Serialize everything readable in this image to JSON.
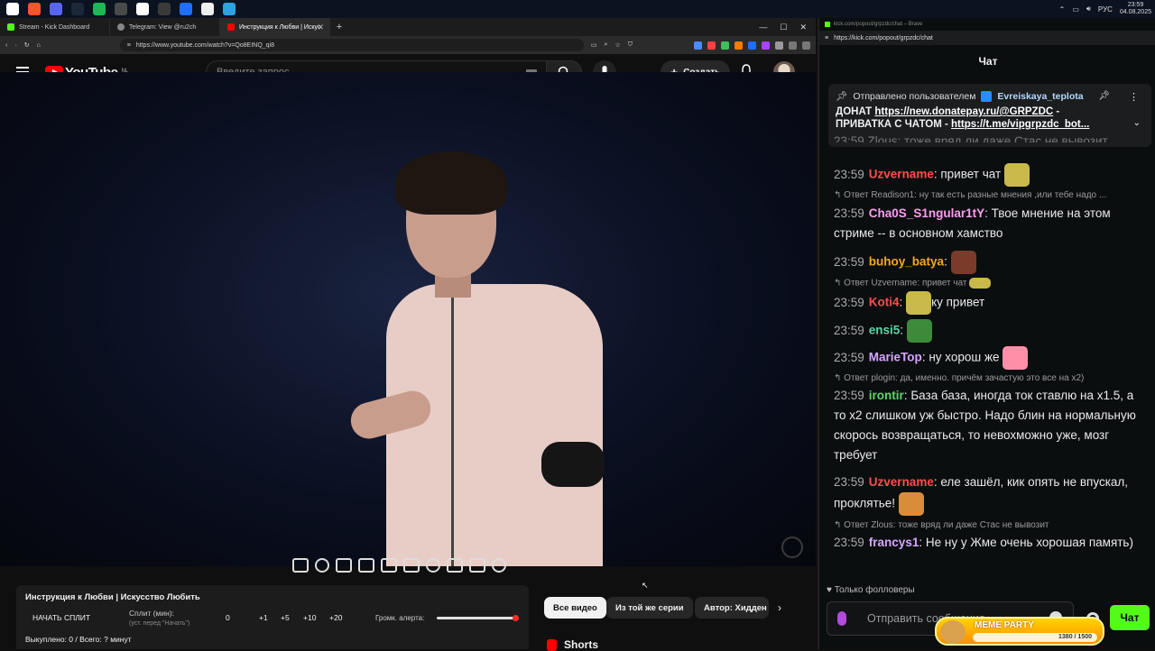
{
  "taskbar": {
    "icons": [
      {
        "name": "start-icon",
        "color": "#ffffff"
      },
      {
        "name": "brave-icon",
        "color": "#fb542b"
      },
      {
        "name": "discord-icon",
        "color": "#5865f2"
      },
      {
        "name": "steam-icon",
        "color": "#1b2838"
      },
      {
        "name": "spotify-icon",
        "color": "#1db954"
      },
      {
        "name": "monitor-icon",
        "color": "#4a4a4a"
      },
      {
        "name": "capcut-icon",
        "color": "#ffffff"
      },
      {
        "name": "obs-icon",
        "color": "#3a3a3a"
      },
      {
        "name": "app-blue-icon",
        "color": "#1f6fff"
      },
      {
        "name": "app-arrow-icon",
        "color": "#eeeeee"
      },
      {
        "name": "telegram-icon",
        "color": "#2aa3e0"
      }
    ],
    "lang": "РУС",
    "time": "23:59",
    "date": "04.08.2025"
  },
  "browser": {
    "tabs": [
      {
        "label": "Stream - Kick Dashboard",
        "color": "#53fc18"
      },
      {
        "label": "Telegram: View @ru2ch",
        "color": "#cccccc"
      },
      {
        "label": "Инструкция к Любви | Искус",
        "color": "#ff0000"
      }
    ],
    "url": "https://www.youtube.com/watch?v=Qo8EINQ_qi8"
  },
  "youtube": {
    "logo": "YouTube",
    "region": "NL",
    "search_placeholder": "Введите запрос",
    "create_label": "Создать"
  },
  "split_panel": {
    "title": "Инструкция к Любви | Искусство Любить",
    "start_label": "НАЧАТЬ СПЛИТ",
    "split_label": "Сплит (мин):",
    "split_hint": "(уст. перед \"Начать\")",
    "value": "0",
    "increments": [
      "+1",
      "+5",
      "+10",
      "+20"
    ],
    "volume_label": "Громк. алерта:",
    "volume_level": 1.0,
    "bought": "Выкуплено: 0 / Всего: ? минут"
  },
  "chips": [
    "Все видео",
    "Из той же серии",
    "Автор: Хидден"
  ],
  "shorts_label": "Shorts",
  "chat_window": {
    "title": "kick.com/popout/grpzdc/chat – Brave",
    "url": "https://kick.com/popout/grpzdc/chat",
    "heading": "Чат",
    "pinned": {
      "prefix": "Отправлено пользователем",
      "user": "Evreiskaya_teplota",
      "line1_label": "ДОНАТ",
      "line1_link": "https://new.donatepay.ru/@GRPZDC",
      "line1_suffix": " -",
      "line2_label": "ПРИВАТКА С ЧАТОМ - ",
      "line2_link": "https://t.me/vipgrpzdc_bot..."
    },
    "behind_pinned": "23:59  Zlous: тоже вряд ли даже Стас не вывозит",
    "messages": [
      {
        "time": "23:59",
        "user": "Uzvername",
        "color": "#ff4d4d",
        "text": "привет чат"
      },
      {
        "reply": "Ответ Readison1: ну так есть разные мнения ,или тебе надо ..."
      },
      {
        "time": "23:59",
        "user": "Cha0S_S1ngular1tY",
        "color": "#ff9cf0",
        "text": "Твое мнение на этом стриме -- в основном хамство"
      },
      {
        "time": "23:59",
        "user": "buhoy_batya",
        "color": "#f5a623",
        "text": ""
      },
      {
        "reply": "Ответ Uzvername: привет чат"
      },
      {
        "time": "23:59",
        "user": "Koti4",
        "color": "#ff4d4d",
        "text": "ку привет"
      },
      {
        "time": "23:59",
        "user": "ensi5",
        "color": "#5fd3a5",
        "text": ""
      },
      {
        "time": "23:59",
        "user": "MarieTop",
        "color": "#d7a6ff",
        "text": "ну хорош же"
      },
      {
        "reply": "Ответ plogin: да, именно. причём зачастую это все на x2)"
      },
      {
        "time": "23:59",
        "user": "irontir",
        "color": "#5fd36b",
        "text": "База база, иногда ток ставлю на x1.5, а то x2 слишком уж быстро. Надо блин на нормальную скорось возвращаться, то невохможно уже, мозг требует"
      },
      {
        "time": "23:59",
        "user": "Uzvername",
        "color": "#ff4d4d",
        "text": "еле зашёл, кик опять не впускал, проклятье!"
      },
      {
        "reply": "Ответ Zlous: тоже вряд ли даже Стас не вывозит"
      },
      {
        "time": "23:59",
        "user": "francys1",
        "color": "#d7a6ff",
        "text": "Не ну у Жме очень хорошая память)"
      }
    ],
    "followers_only": "Только фолловеры",
    "input_placeholder": "Отправить сообщение",
    "send_label": "Чат",
    "meme_party": {
      "title": "MEME PARTY",
      "progress": "1380 / 1500",
      "fraction": 0.92
    }
  }
}
